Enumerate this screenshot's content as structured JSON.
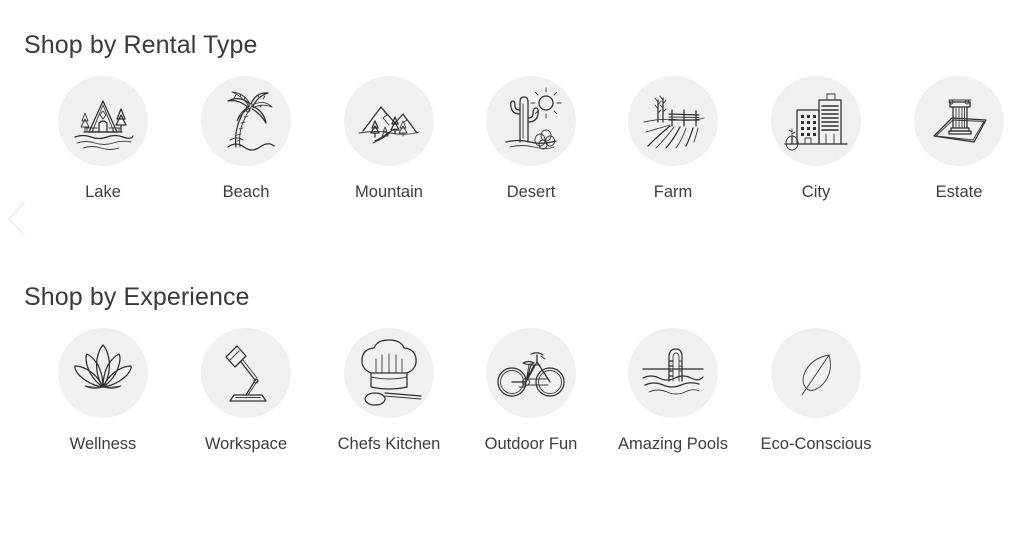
{
  "sections": [
    {
      "id": "rental",
      "title": "Shop by Rental Type",
      "items": [
        {
          "label": "Lake",
          "icon": "lake-cabin-icon"
        },
        {
          "label": "Beach",
          "icon": "palm-tree-icon"
        },
        {
          "label": "Mountain",
          "icon": "mountain-icon"
        },
        {
          "label": "Desert",
          "icon": "cactus-sun-icon"
        },
        {
          "label": "Farm",
          "icon": "farm-field-fence-icon"
        },
        {
          "label": "City",
          "icon": "city-buildings-icon"
        },
        {
          "label": "Estate",
          "icon": "classical-column-icon"
        }
      ]
    },
    {
      "id": "experience",
      "title": "Shop by Experience",
      "items": [
        {
          "label": "Wellness",
          "icon": "lotus-flower-icon"
        },
        {
          "label": "Workspace",
          "icon": "desk-lamp-icon"
        },
        {
          "label": "Chefs Kitchen",
          "icon": "chef-hat-spoon-icon"
        },
        {
          "label": "Outdoor Fun",
          "icon": "bicycle-icon"
        },
        {
          "label": "Amazing Pools",
          "icon": "pool-ladder-icon"
        },
        {
          "label": "Eco-Conscious",
          "icon": "leaf-icon"
        }
      ]
    }
  ],
  "carousel": {
    "prev_icon": "chevron-left-icon",
    "prev_label": "Previous"
  },
  "colors": {
    "background": "#ffffff",
    "circle_fill": "#f1f0ee",
    "text": "#3a3a3a",
    "sketch_stroke": "#2e2e2e",
    "chevron": "#f0f0f0"
  }
}
